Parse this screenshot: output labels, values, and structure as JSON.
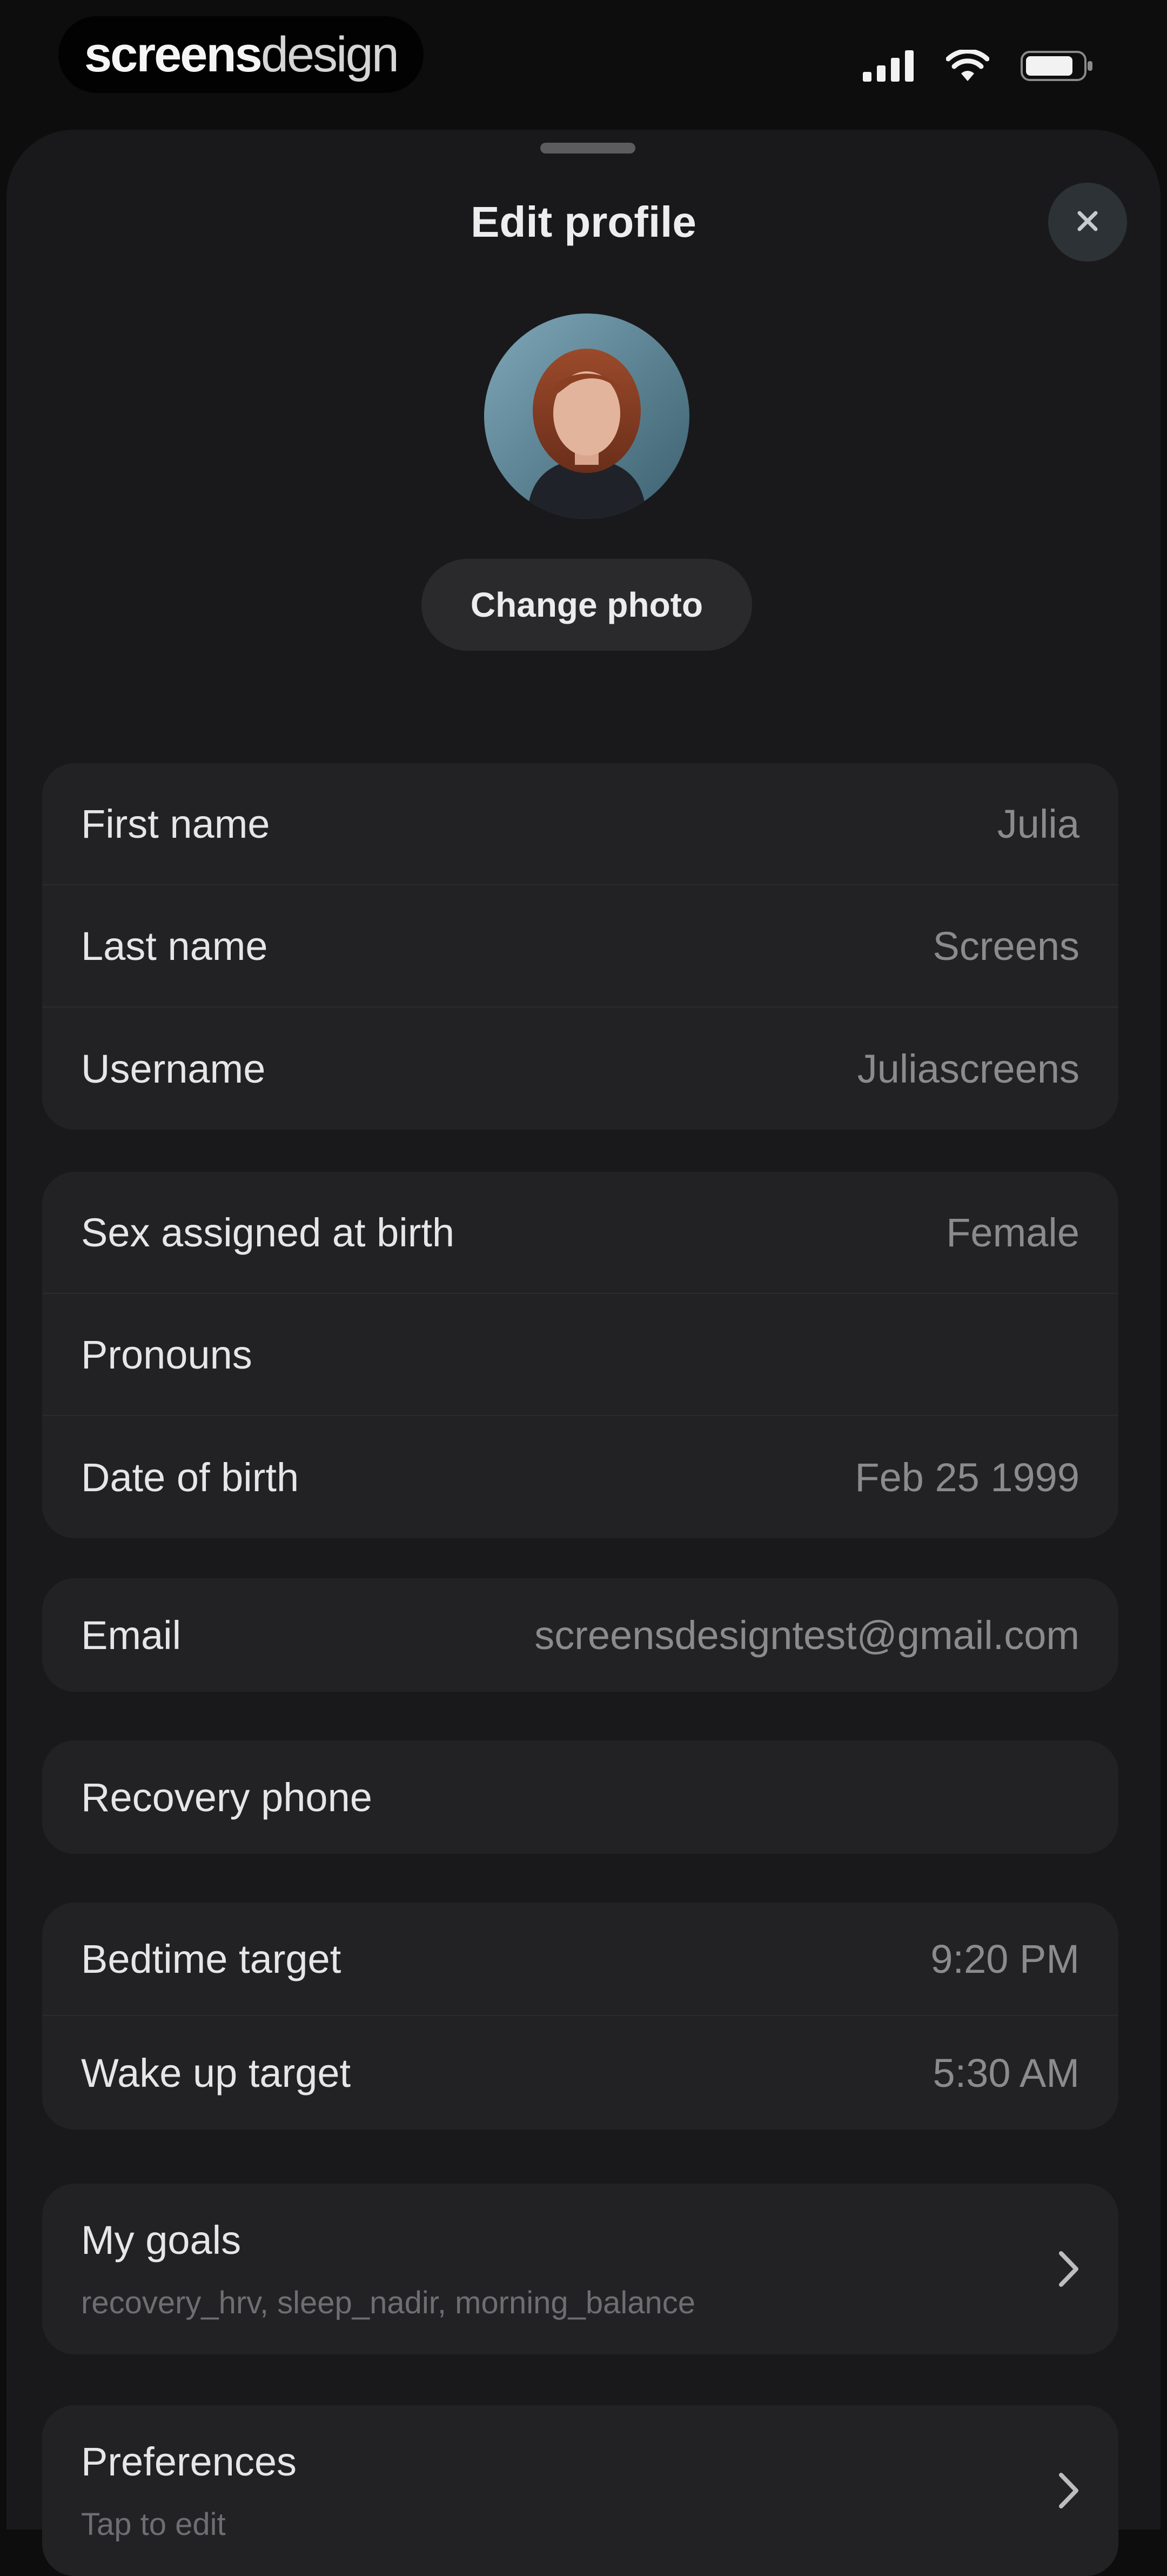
{
  "status_bar": {
    "brand_part1": "screens",
    "brand_part2": "design",
    "icons": [
      "signal-icon",
      "wifi-icon",
      "battery-icon"
    ]
  },
  "sheet": {
    "title": "Edit profile",
    "change_photo_label": "Change photo"
  },
  "sections": {
    "name": [
      {
        "label": "First name",
        "value": "Julia"
      },
      {
        "label": "Last name",
        "value": "Screens"
      },
      {
        "label": "Username",
        "value": "Juliascreens"
      }
    ],
    "personal": [
      {
        "label": "Sex assigned at birth",
        "value": "Female"
      },
      {
        "label": "Pronouns",
        "value": ""
      },
      {
        "label": "Date of birth",
        "value": "Feb 25 1999"
      }
    ],
    "email": {
      "label": "Email",
      "value": "screensdesigntest@gmail.com"
    },
    "recovery": {
      "label": "Recovery phone",
      "value": ""
    },
    "sleep": [
      {
        "label": "Bedtime target",
        "value": "9:20 PM"
      },
      {
        "label": "Wake up target",
        "value": "5:30 AM"
      }
    ],
    "goals": {
      "label": "My goals",
      "subtitle": "recovery_hrv, sleep_nadir, morning_balance"
    },
    "preferences": {
      "label": "Preferences",
      "subtitle": "Tap to edit"
    }
  },
  "colors": {
    "background": "#0d0d0e",
    "sheet": "#19191b",
    "card": "#222224",
    "primary_text": "#e6e6e7",
    "secondary_text": "#8b8b8e"
  }
}
